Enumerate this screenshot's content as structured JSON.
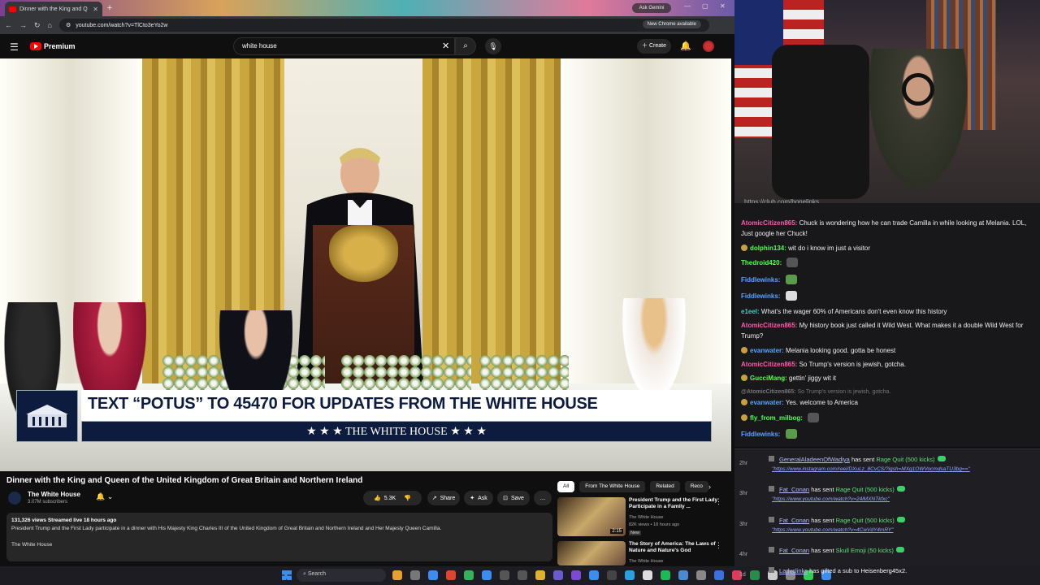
{
  "browser": {
    "tab_title": "Dinner with the King and Q",
    "url": "youtube.com/watch?v=TlCto3eYo2w",
    "ask_gemini": "Ask Gemini",
    "new_chrome": "New Chrome available"
  },
  "youtube": {
    "logo_text": "Premium",
    "search_value": "white house",
    "create_label": "Create"
  },
  "video": {
    "lower_third_top": "TEXT “POTUS” TO 45470 FOR UPDATES FROM THE WHITE HOUSE",
    "lower_third_bottom": "★ ★ ★  THE WHITE HOUSE  ★ ★ ★",
    "title": "Dinner with the King and Queen of the United Kingdom of Great Britain and Northern Ireland",
    "channel": "The White House",
    "subscribers": "3.07M subscribers",
    "likes": "5.3K",
    "share": "Share",
    "ask": "Ask",
    "save": "Save",
    "more": "…",
    "views_line": "131,326 views  Streamed live 18 hours ago",
    "description": "President Trump and the First Lady participate in a dinner with His Majesty King Charles III of the United Kingdom of Great Britain and Northern Ireland and Her Majesty Queen Camilla.",
    "desc_channel": "The White House"
  },
  "sidebar": {
    "chips": [
      "All",
      "From The White House",
      "Related",
      "Reco"
    ],
    "recs": [
      {
        "title": "President Trump and the First Lady Participate in a Family ...",
        "channel": "The White House",
        "meta": "82K views • 18 hours ago",
        "badge": "New",
        "duration": "2:15"
      },
      {
        "title": "The Story of America: The Laws of Nature and Nature's God",
        "channel": "The White House",
        "meta": "",
        "badge": "",
        "duration": ""
      }
    ]
  },
  "stream": {
    "link": "https://club.com/bonelinks",
    "chat": [
      {
        "user": "AtomicCitizen865",
        "color": "#ff5ca8",
        "text": "Chuck is wondering how he can trade Camilla in while looking at Melania. LOL, Just google her Chuck!",
        "badge": false
      },
      {
        "user": "dolphin134",
        "color": "#4cff4c",
        "text": "wit do i know im just a visitor",
        "badge": true
      },
      {
        "user": "Thedroid420",
        "color": "#4cff4c",
        "text": "",
        "badge": false
      },
      {
        "user": "Fiddlewinks",
        "color": "#5aa2ff",
        "text": "",
        "badge": false
      },
      {
        "user": "Fiddlewinks",
        "color": "#5aa2ff",
        "text": "",
        "badge": false
      },
      {
        "user": "e1eel",
        "color": "#3ad0c0",
        "text": "What's the wager 60% of Americans don't even know this history",
        "badge": false
      },
      {
        "user": "AtomicCitizen865",
        "color": "#ff5ca8",
        "text": "My history book just called it Wild West. What makes it a double Wild West for Trump?",
        "badge": false
      },
      {
        "user": "evanwater",
        "color": "#5aa2ff",
        "text": "Melania looking good. gotta be honest",
        "badge": true
      },
      {
        "user": "AtomicCitizen865",
        "color": "#ff5ca8",
        "text": "So Trump's version is jewish, gotcha.",
        "badge": false
      },
      {
        "user": "GucciMang",
        "color": "#4cff4c",
        "text": "gettin' jiggy wit it",
        "badge": true
      },
      {
        "user": "@AtomicCitizen865",
        "color": "#777777",
        "text": "So Trump's version is jewish, gotcha.",
        "badge": false,
        "reply": true
      },
      {
        "user": "evanwater",
        "color": "#5aa2ff",
        "text": "Yes. welcome to America",
        "badge": true
      },
      {
        "user": "fly_from_milbog",
        "color": "#4cff4c",
        "text": "",
        "badge": true
      },
      {
        "user": "Fiddlewinks",
        "color": "#5aa2ff",
        "text": "",
        "badge": false
      }
    ],
    "events": [
      {
        "time": "2hr",
        "user": "GeneralAladeenOfWadiya",
        "action": "has sent",
        "reward": "Rage Quit (500 kicks)",
        "link": "https://www.instagram.com/reel/DXuLz_8CvCS/?igsh=MXg1OWVocmdsaTU3bg=="
      },
      {
        "time": "3hr",
        "user": "Fat_Conan",
        "action": "has sent",
        "reward": "Rage Quit (500 kicks)",
        "link": "https://www.youtube.com/watch?v=24lMXNTkfxc"
      },
      {
        "time": "3hr",
        "user": "Fat_Conan",
        "action": "has sent",
        "reward": "Rage Quit (500 kicks)",
        "link": "https://www.youtube.com/watch?v=4CwVdY4mRY"
      },
      {
        "time": "4hr",
        "user": "Fat_Conan",
        "action": "has sent",
        "reward": "Skull Emoji (50 kicks)",
        "link": ""
      },
      {
        "time": "1d",
        "user": "Ladyclinks",
        "action": "has gifted a sub to",
        "reward": "Heisenberg45x2.",
        "link": ""
      }
    ]
  },
  "taskbar": {
    "search": "Search"
  }
}
